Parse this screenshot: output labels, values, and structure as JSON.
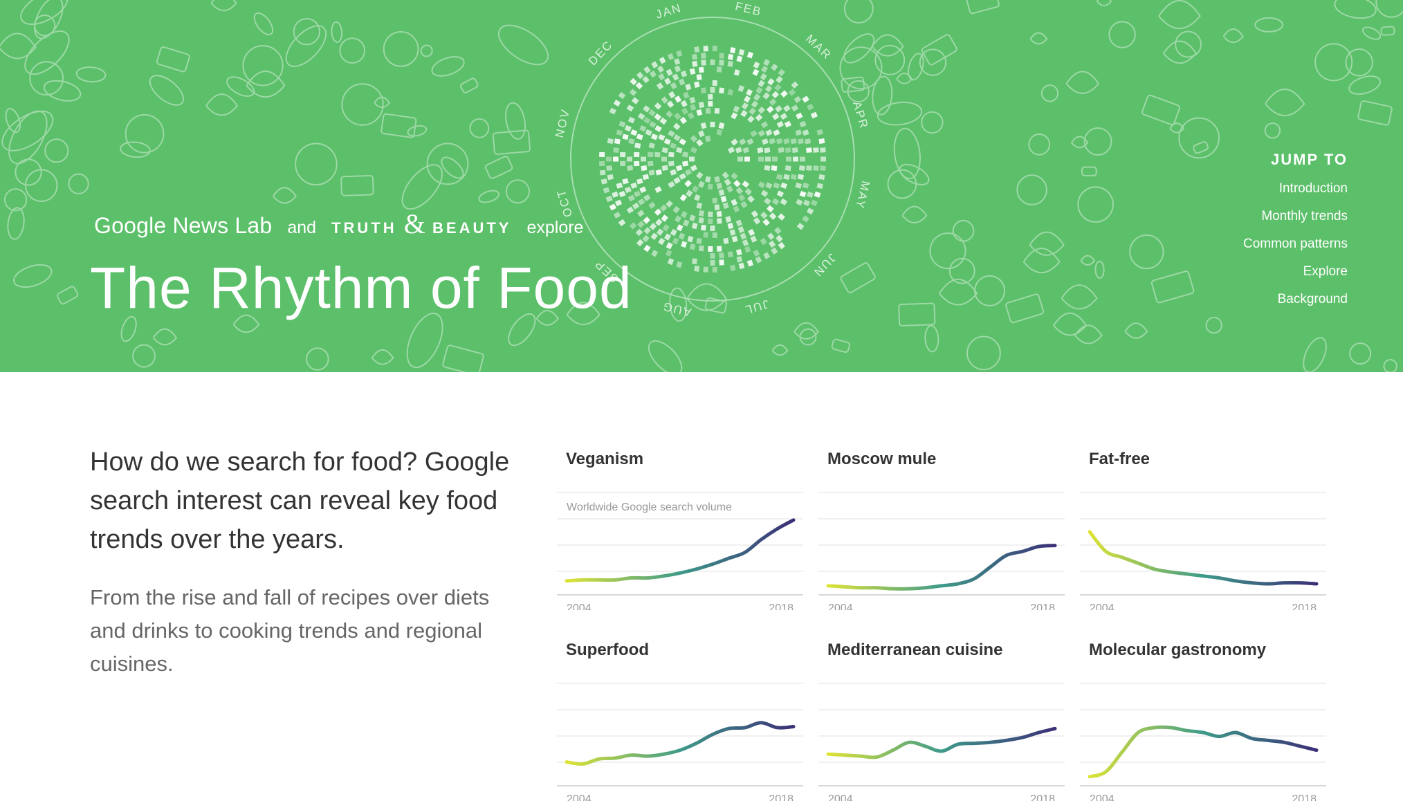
{
  "header": {
    "byline": {
      "google_news_lab": "Google News Lab",
      "and": "and",
      "truth": "TRUTH",
      "amp": "&",
      "beauty": "BEAUTY",
      "explore": "explore"
    },
    "title": "The Rhythm of Food",
    "months": [
      "JAN",
      "FEB",
      "MAR",
      "APR",
      "MAY",
      "JUN",
      "JUL",
      "AUG",
      "SEP",
      "OCT",
      "NOV",
      "DEC"
    ],
    "background_color": "#5cbf6a",
    "doodle_color": "#a8deb0"
  },
  "nav": {
    "title": "JUMP TO",
    "items": [
      "Introduction",
      "Monthly trends",
      "Common patterns",
      "Explore",
      "Background"
    ]
  },
  "intro": {
    "heading": "How do we search for food? Google search interest can reveal key food trends over the years.",
    "body": "From the rise and fall of recipes over diets and drinks to cooking trends and regional cuisines."
  },
  "chart_data": [
    {
      "type": "line",
      "title": "Veganism",
      "ylabel": "Worldwide Google search volume",
      "x_start": "2004",
      "x_end": "2018",
      "x": [
        2004,
        2005,
        2006,
        2007,
        2008,
        2009,
        2010,
        2011,
        2012,
        2013,
        2014,
        2015,
        2016,
        2017,
        2018
      ],
      "values": [
        10,
        11,
        11,
        11,
        13,
        13,
        15,
        18,
        22,
        27,
        33,
        39,
        52,
        63,
        72
      ],
      "ylim": [
        0,
        100
      ],
      "gradient": [
        "#dde336",
        "#3e9b8a",
        "#3b2f77"
      ]
    },
    {
      "type": "line",
      "title": "Moscow mule",
      "x_start": "2004",
      "x_end": "2018",
      "x": [
        2004,
        2005,
        2006,
        2007,
        2008,
        2009,
        2010,
        2011,
        2012,
        2013,
        2014,
        2015,
        2016,
        2017,
        2018
      ],
      "values": [
        5,
        4,
        3,
        3,
        2,
        2,
        3,
        5,
        7,
        12,
        24,
        36,
        40,
        45,
        46
      ],
      "ylim": [
        0,
        100
      ],
      "gradient": [
        "#dde336",
        "#3e9b8a",
        "#3b2f77"
      ]
    },
    {
      "type": "line",
      "title": "Fat-free",
      "x_start": "2004",
      "x_end": "2018",
      "x": [
        2004,
        2005,
        2006,
        2007,
        2008,
        2009,
        2010,
        2011,
        2012,
        2013,
        2014,
        2015,
        2016,
        2017,
        2018
      ],
      "values": [
        60,
        40,
        34,
        28,
        22,
        19,
        17,
        15,
        13,
        10,
        8,
        7,
        8,
        8,
        7
      ],
      "ylim": [
        0,
        100
      ],
      "gradient": [
        "#dde336",
        "#3e9b8a",
        "#3b2f77"
      ]
    },
    {
      "type": "line",
      "title": "Superfood",
      "x_start": "2004",
      "x_end": "2018",
      "x": [
        2004,
        2005,
        2006,
        2007,
        2008,
        2009,
        2010,
        2011,
        2012,
        2013,
        2014,
        2015,
        2016,
        2017,
        2018
      ],
      "values": [
        20,
        18,
        23,
        24,
        27,
        26,
        28,
        32,
        39,
        48,
        54,
        55,
        60,
        55,
        56
      ],
      "ylim": [
        0,
        100
      ],
      "gradient": [
        "#dde336",
        "#3e9b8a",
        "#3b2f77"
      ]
    },
    {
      "type": "line",
      "title": "Mediterranean cuisine",
      "x_start": "2004",
      "x_end": "2018",
      "x": [
        2004,
        2005,
        2006,
        2007,
        2008,
        2009,
        2010,
        2011,
        2012,
        2013,
        2014,
        2015,
        2016,
        2017,
        2018
      ],
      "values": [
        28,
        27,
        26,
        25,
        32,
        40,
        36,
        31,
        38,
        39,
        40,
        42,
        45,
        50,
        54
      ],
      "ylim": [
        0,
        100
      ],
      "gradient": [
        "#dde336",
        "#3e9b8a",
        "#3b2f77"
      ]
    },
    {
      "type": "line",
      "title": "Molecular gastronomy",
      "x_start": "2004",
      "x_end": "2018",
      "x": [
        2004,
        2005,
        2006,
        2007,
        2008,
        2009,
        2010,
        2011,
        2012,
        2013,
        2014,
        2015,
        2016,
        2017,
        2018
      ],
      "values": [
        5,
        10,
        30,
        50,
        55,
        55,
        52,
        50,
        46,
        50,
        44,
        42,
        40,
        36,
        32
      ],
      "ylim": [
        0,
        100
      ],
      "gradient": [
        "#dde336",
        "#3e9b8a",
        "#3b2f77"
      ]
    }
  ]
}
